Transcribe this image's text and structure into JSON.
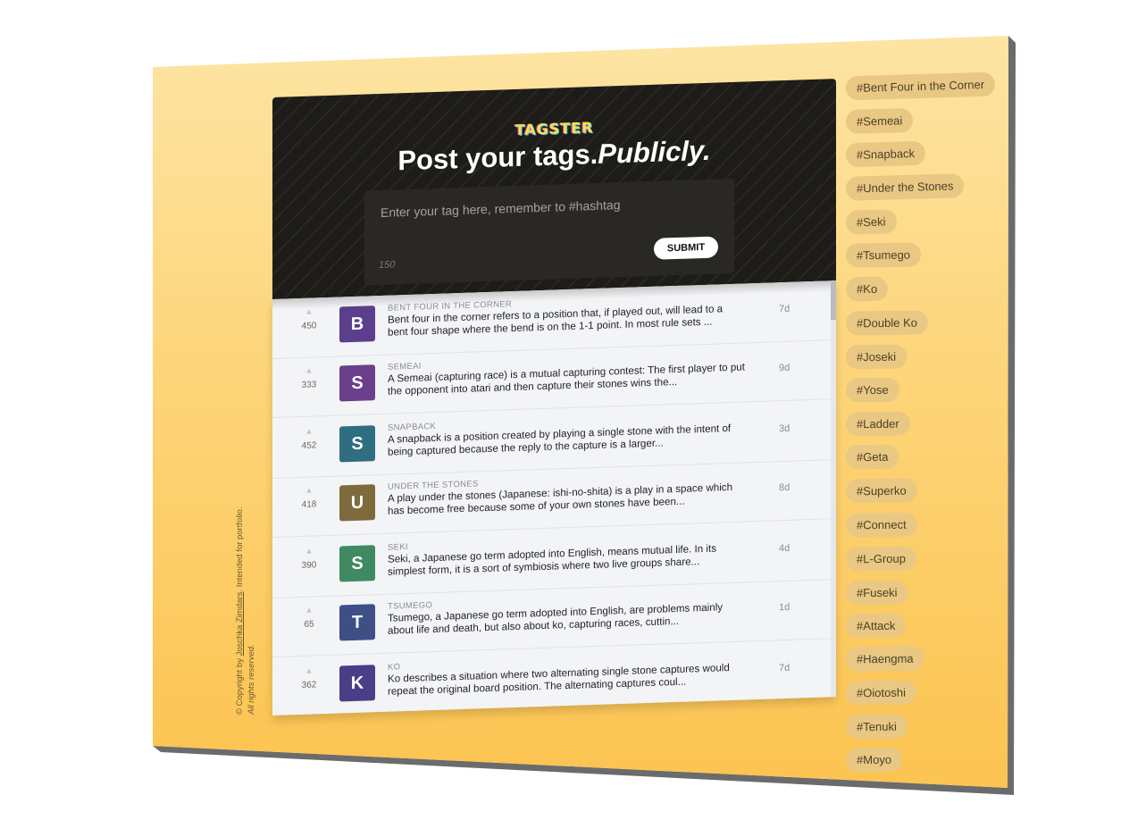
{
  "copyright": {
    "line1_prefix": "© Copyright by ",
    "author": "Joschka Zimdars",
    "line1_suffix": ". Intended for portfolio.",
    "line2": "All rights reserved."
  },
  "header": {
    "logo": "TAGSTER",
    "headline_main": "Post your tags.",
    "headline_accent": "Publicly.",
    "input_placeholder": "Enter your tag here, remember to #hashtag",
    "char_counter": "150",
    "submit_label": "SUBMIT"
  },
  "feed": [
    {
      "votes": "450",
      "initial": "B",
      "color": "#5b3f8c",
      "tag": "BENT FOUR IN THE CORNER",
      "text": "Bent four in the corner refers to a position that, if played out, will lead to a bent four shape where the bend is on the 1-1 point. In most rule sets ...",
      "age": "7d"
    },
    {
      "votes": "333",
      "initial": "S",
      "color": "#6b3f8a",
      "tag": "SEMEAI",
      "text": "A Semeai (capturing race) is a mutual capturing contest: The first player to put the opponent into atari and then capture their stones wins the...",
      "age": "9d"
    },
    {
      "votes": "452",
      "initial": "S",
      "color": "#2f6e80",
      "tag": "SNAPBACK",
      "text": "A snapback is a position created by playing a single stone with the intent of being captured because the reply to the capture is a larger...",
      "age": "3d"
    },
    {
      "votes": "418",
      "initial": "U",
      "color": "#7f6a3e",
      "tag": "UNDER THE STONES",
      "text": "A play under the stones (Japanese: ishi-no-shita) is a play in a space which has become free because some of your own stones have been...",
      "age": "8d"
    },
    {
      "votes": "390",
      "initial": "S",
      "color": "#3f8a63",
      "tag": "SEKI",
      "text": "Seki, a Japanese go term adopted into English, means mutual life. In its simplest form, it is a sort of symbiosis where two live groups share...",
      "age": "4d"
    },
    {
      "votes": "65",
      "initial": "T",
      "color": "#3e4f86",
      "tag": "TSUMEGO",
      "text": "Tsumego, a Japanese go term adopted into English, are problems mainly about life and death, but also about ko, capturing races, cuttin...",
      "age": "1d"
    },
    {
      "votes": "362",
      "initial": "K",
      "color": "#4a3e86",
      "tag": "KO",
      "text": "Ko describes a situation where two alternating single stone captures would repeat the original board position. The alternating captures coul...",
      "age": "7d"
    }
  ],
  "tags": [
    "#Bent Four in the Corner",
    "#Semeai",
    "#Snapback",
    "#Under the Stones",
    "#Seki",
    "#Tsumego",
    "#Ko",
    "#Double Ko",
    "#Joseki",
    "#Yose",
    "#Ladder",
    "#Geta",
    "#Superko",
    "#Connect",
    "#L-Group",
    "#Fuseki",
    "#Attack",
    "#Haengma",
    "#Oiotoshi",
    "#Tenuki",
    "#Moyo"
  ]
}
